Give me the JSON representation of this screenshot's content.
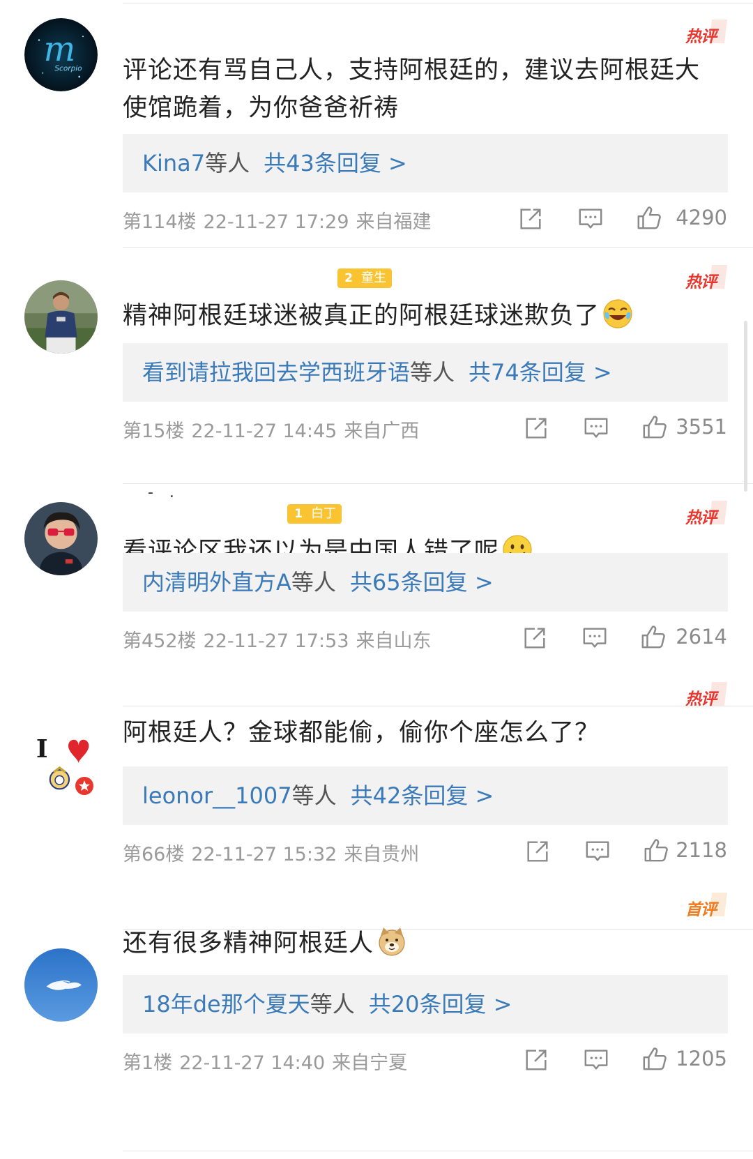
{
  "comments": [
    {
      "username": "",
      "user_badge": "",
      "hot_label": "热评",
      "text": "评论还有骂自己人，支持阿根廷的，建议去阿根廷大使馆跪着，为你爸爸祈祷",
      "emoji": "",
      "reply_names": "Kina7",
      "reply_etal": "等人",
      "reply_count": "共43条回复 >",
      "floor": "第114楼",
      "datetime": "22-11-27 17:29",
      "location": "来自福建",
      "likes": "4290",
      "avatar": "scorpio-avatar"
    },
    {
      "username": "",
      "user_badge_num": "2",
      "user_badge": "童生",
      "hot_label": "热评",
      "text": "精神阿根廷球迷被真正的阿根廷球迷欺负了",
      "emoji": "laughing-crying-emoji",
      "reply_names": "看到请拉我回去学西班牙语",
      "reply_etal": "等人",
      "reply_count": "共74条回复 >",
      "floor": "第15楼",
      "datetime": "22-11-27 14:45",
      "location": "来自广西",
      "likes": "3551",
      "avatar": "football-player-avatar"
    },
    {
      "username": "- .",
      "user_badge_num": "1",
      "user_badge": "白丁",
      "hot_label": "热评",
      "text": "看评论区我还以为是中国人错了呢",
      "emoji": "smile-emoji",
      "reply_names": "内清明外直方A",
      "reply_etal": "等人",
      "reply_count": "共65条回复 >",
      "floor": "第452楼",
      "datetime": "22-11-27 17:53",
      "location": "来自山东",
      "likes": "2614",
      "avatar": "boy-sunglasses-avatar"
    },
    {
      "username": "",
      "user_badge": "",
      "hot_label": "热评",
      "text": "阿根廷人？金球都能偷，偷你个座怎么了？",
      "emoji": "",
      "reply_names": "leonor__1007",
      "reply_etal": "等人",
      "reply_count": "共42条回复 >",
      "floor": "第66楼",
      "datetime": "22-11-27 15:32",
      "location": "来自贵州",
      "likes": "2118",
      "avatar": "i-love-real-madrid-avatar",
      "avatar_text": "I"
    },
    {
      "username": "",
      "user_badge": "",
      "hot_label": "首评",
      "text": "还有很多精神阿根廷人",
      "emoji": "doge-emoji",
      "reply_names": "18年de那个夏天",
      "reply_etal": "等人",
      "reply_count": "共20条回复 >",
      "floor": "第1楼",
      "datetime": "22-11-27 14:40",
      "location": "来自宁夏",
      "likes": "1205",
      "avatar": "blue-sky-cloud-avatar"
    }
  ],
  "icons": {
    "share": "share-icon",
    "comment": "comment-icon",
    "like": "thumbs-up-icon"
  },
  "colors": {
    "link": "#3b7ab8",
    "hot": "#e8372f",
    "first": "#f07a1e",
    "meta": "#9a9a9a",
    "badge": "#f9c331"
  }
}
